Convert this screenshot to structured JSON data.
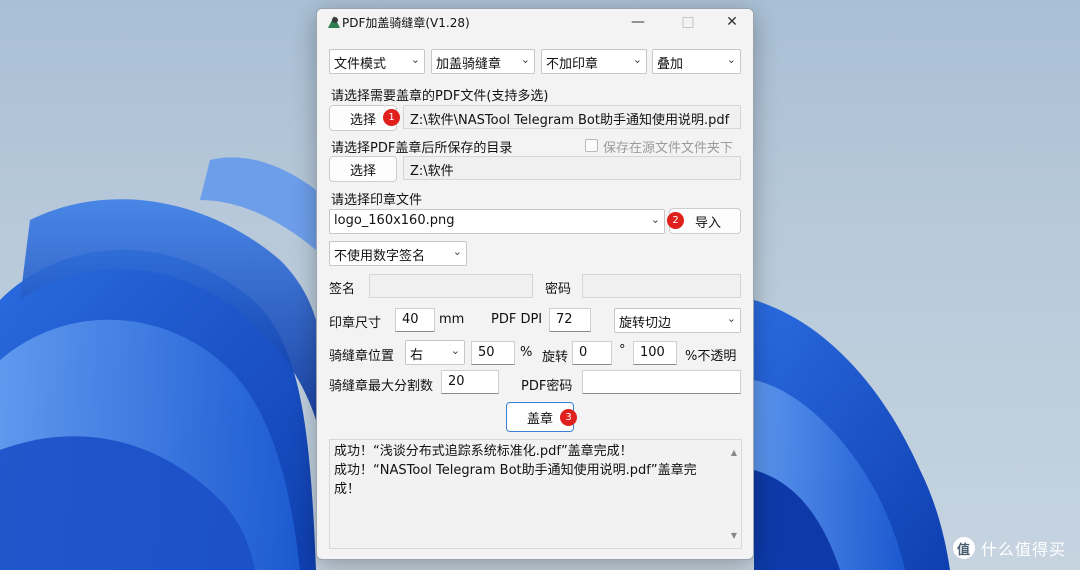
{
  "window": {
    "title": "PDF加盖骑缝章(V1.28)"
  },
  "toolbar": {
    "mode": "文件模式",
    "stamp_type": "加盖骑缝章",
    "seal_option": "不加印章",
    "overlay": "叠加"
  },
  "pdf_select": {
    "label": "请选择需要盖章的PDF文件(支持多选)",
    "button": "选择",
    "badge": "1",
    "path": "Z:\\软件\\NASTool Telegram Bot助手通知使用说明.pdf"
  },
  "save_dir": {
    "label": "请选择PDF盖章后所保存的目录",
    "checkbox_label": "保存在源文件文件夹下",
    "button": "选择",
    "path": "Z:\\软件"
  },
  "seal_file": {
    "label": "请选择印章文件",
    "file": "logo_160x160.png",
    "badge": "2",
    "import_button": "导入"
  },
  "signature": {
    "mode": "不使用数字签名",
    "sign_label": "签名",
    "password_label": "密码"
  },
  "params": {
    "size_label": "印章尺寸",
    "size_value": "40",
    "size_unit": "mm",
    "dpi_label": "PDF DPI",
    "dpi_value": "72",
    "rotate_mode": "旋转切边",
    "position_label": "骑缝章位置",
    "position_value": "右",
    "position_pct": "50",
    "pct_symbol": "%",
    "rotation_label": "旋转",
    "rotation_value": "0",
    "degree_symbol": "°",
    "opacity_value": "100",
    "opacity_label": "%不透明",
    "max_split_label": "骑缝章最大分割数",
    "max_split_value": "20",
    "pdf_password_label": "PDF密码"
  },
  "action": {
    "stamp_button": "盖章",
    "badge": "3"
  },
  "log": {
    "lines": [
      "成功！“浅谈分布式追踪系统标准化.pdf”盖章完成！",
      "成功！“NASTool Telegram Bot助手通知使用说明.pdf”盖章完成！"
    ]
  },
  "watermark": {
    "text": "什么值得买",
    "logo": "值"
  },
  "icons": {
    "chevron": "chevron-down-icon",
    "minimize": "minimize-icon",
    "maximize": "maximize-icon",
    "close": "close-icon"
  },
  "colors": {
    "badge": "#e0201c",
    "accent_border": "#3c7fd6"
  }
}
